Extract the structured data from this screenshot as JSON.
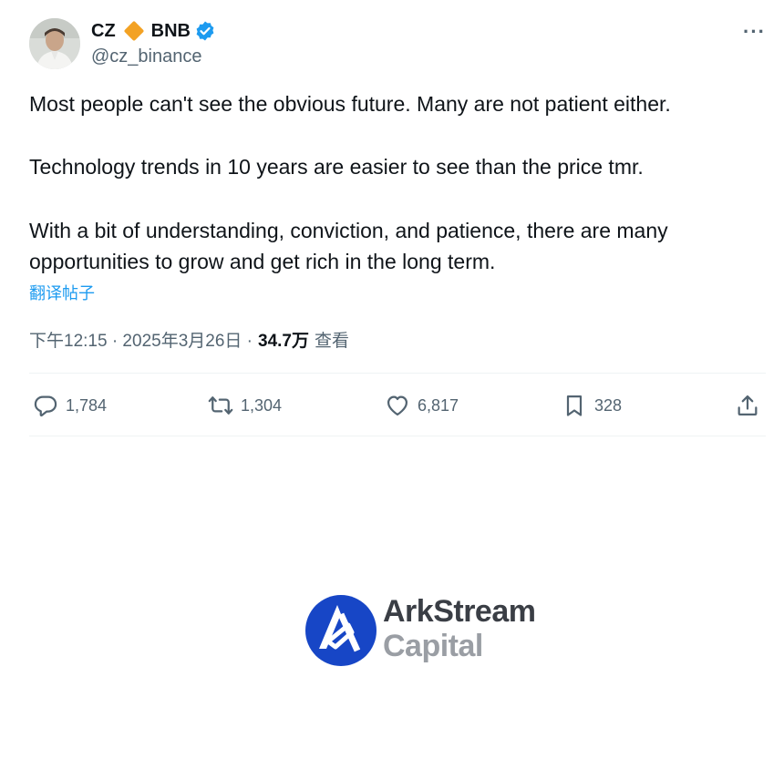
{
  "tweet": {
    "display_name": "CZ",
    "display_name_suffix": "BNB",
    "handle": "@cz_binance",
    "more_label": "···",
    "paragraphs": [
      "Most people can't see the obvious future. Many are not patient either.",
      "Technology trends in 10 years are easier to see than the price tmr.",
      "With a bit of understanding, conviction, and patience, there are many opportunities to grow and get rich in the long term."
    ],
    "translate_label": "翻译帖子",
    "timestamp": "下午12:15 · 2025年3月26日 ·",
    "views_count": "34.7万",
    "views_label": "查看",
    "actions": {
      "replies": "1,784",
      "reposts": "1,304",
      "likes": "6,817",
      "bookmarks": "328"
    },
    "icons": {
      "verified": "verified-badge-icon",
      "diamond": "bnb-diamond-icon",
      "reply": "reply-icon",
      "repost": "repost-icon",
      "like": "heart-icon",
      "bookmark": "bookmark-icon",
      "share": "share-icon"
    },
    "colors": {
      "accent": "#1d9bf0",
      "diamond": "#f3a224",
      "muted": "#536471"
    }
  },
  "watermark": {
    "line1": "ArkStream",
    "line2": "Capital",
    "brand_color": "#1746c6"
  }
}
